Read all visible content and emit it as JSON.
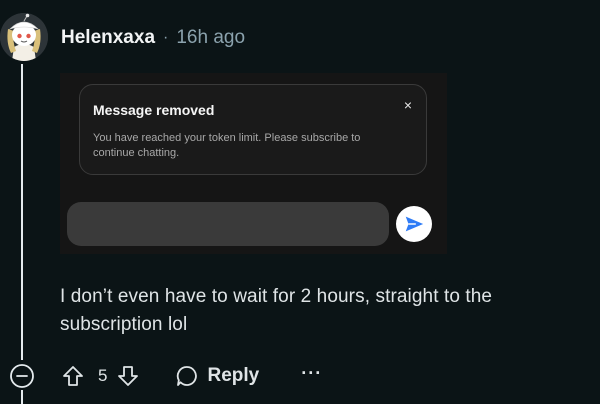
{
  "comment": {
    "author": "Helenxaxa",
    "separator": "·",
    "timestamp": "16h ago",
    "avatar_icon": "snoo-avatar-icon",
    "text": "I don’t even have to wait for 2 hours, straight to the subscription lol"
  },
  "embedded_screenshot": {
    "notice_title": "Message removed",
    "notice_close": "×",
    "notice_body": "You have reached your token limit. Please subscribe to continue chatting.",
    "send_icon": "send-arrow-icon"
  },
  "actions": {
    "score": "5",
    "reply_label": "Reply",
    "more_label": "···",
    "upvote_icon": "arrow-up-icon",
    "downvote_icon": "arrow-down-icon",
    "reply_icon": "speech-bubble-icon",
    "collapse_icon": "minus-circle-icon"
  },
  "colors": {
    "background": "#0b1416",
    "text": "#dfe4e6",
    "meta": "#8ba2ad",
    "send_arrow": "#2f7cf6"
  }
}
